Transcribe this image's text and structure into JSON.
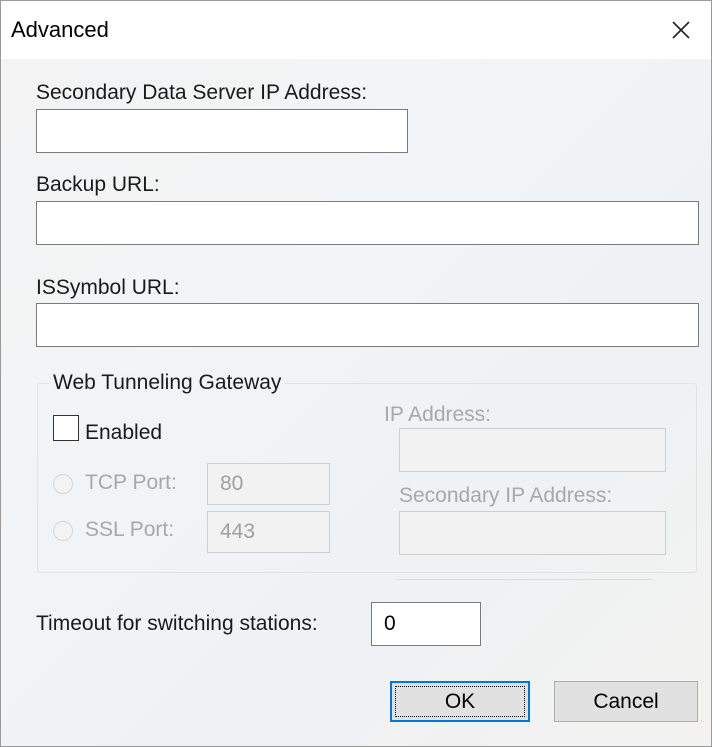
{
  "window": {
    "title": "Advanced",
    "close_symbol": "✕"
  },
  "fields": {
    "secondary_ip_label": "Secondary Data Server IP Address:",
    "secondary_ip_value": "",
    "backup_url_label": "Backup URL:",
    "backup_url_value": "",
    "issymbol_url_label": "ISSymbol URL:",
    "issymbol_url_value": ""
  },
  "gateway": {
    "group_title": "Web Tunneling Gateway",
    "enabled_label": "Enabled",
    "enabled_checked": false,
    "tcp_port_label": "TCP Port:",
    "tcp_port_value": "80",
    "ssl_port_label": "SSL Port:",
    "ssl_port_value": "443",
    "ip_address_label": "IP Address:",
    "ip_address_value": "",
    "secondary_ip_label": "Secondary IP Address:",
    "secondary_ip_value": ""
  },
  "timeout": {
    "label": "Timeout for switching stations:",
    "value": "0"
  },
  "buttons": {
    "ok_label": "OK",
    "cancel_label": "Cancel"
  },
  "colors": {
    "accent": "#0078d7",
    "disabled_text": "#a8a8a8"
  }
}
